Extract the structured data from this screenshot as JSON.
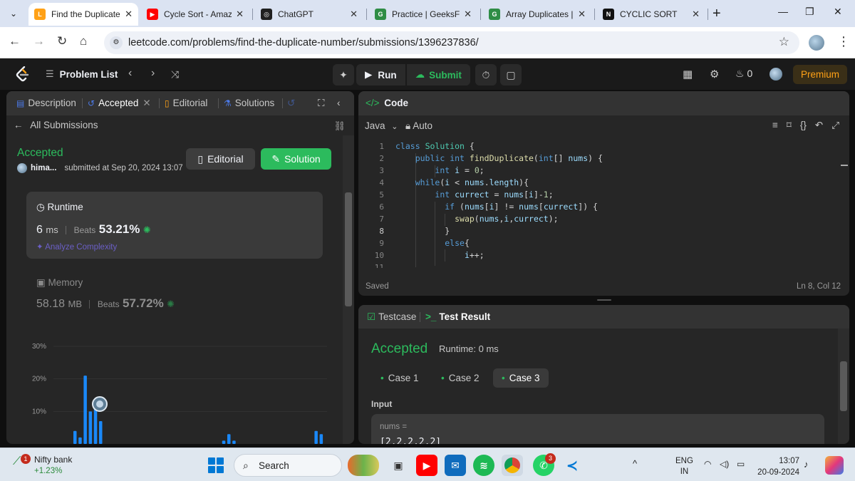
{
  "browser": {
    "tabs": [
      {
        "title": "Find the Duplicate",
        "color": "#ffa116",
        "glyph": "L"
      },
      {
        "title": "Cycle Sort - Amazo",
        "color": "#ff0000",
        "glyph": "▶"
      },
      {
        "title": "ChatGPT",
        "color": "#202020",
        "glyph": "◎"
      },
      {
        "title": "Practice | GeeksFor",
        "color": "#2f8d46",
        "glyph": "G"
      },
      {
        "title": "Array Duplicates |",
        "color": "#2f8d46",
        "glyph": "G"
      },
      {
        "title": "CYCLIC SORT",
        "color": "#111111",
        "glyph": "N"
      }
    ],
    "url": "leetcode.com/problems/find-the-duplicate-number/submissions/1396237836/"
  },
  "lc": {
    "problem_list": "Problem List",
    "run": "Run",
    "submit": "Submit",
    "streak": "0",
    "premium": "Premium"
  },
  "left": {
    "tabs": {
      "description": "Description",
      "accepted": "Accepted",
      "editorial": "Editorial",
      "solutions": "Solutions"
    },
    "all_submissions": "All Submissions",
    "status": "Accepted",
    "user": "hima...",
    "submitted_at": "submitted at Sep 20, 2024 13:07",
    "editorial_btn": "Editorial",
    "solution_btn": "Solution",
    "runtime": {
      "label": "Runtime",
      "value": "6",
      "unit": "ms",
      "beats": "Beats",
      "pct": "53.21%",
      "analyze": "Analyze Complexity"
    },
    "memory": {
      "label": "Memory",
      "value": "58.18",
      "unit": "MB",
      "beats": "Beats",
      "pct": "57.72%"
    }
  },
  "chart_data": {
    "type": "bar",
    "y_tick_labels": [
      "30%",
      "20%",
      "10%"
    ],
    "yticks": [
      30,
      20,
      10
    ],
    "ylim": [
      0,
      30
    ],
    "bars": [
      {
        "x": 0,
        "y": 4
      },
      {
        "x": 1,
        "y": 2
      },
      {
        "x": 2,
        "y": 21
      },
      {
        "x": 3,
        "y": 10
      },
      {
        "x": 4,
        "y": 12
      },
      {
        "x": 5,
        "y": 7
      },
      {
        "x": 29,
        "y": 1
      },
      {
        "x": 30,
        "y": 3
      },
      {
        "x": 31,
        "y": 1
      },
      {
        "x": 47,
        "y": 4
      },
      {
        "x": 48,
        "y": 3
      }
    ],
    "color": "#1a88f8"
  },
  "code": {
    "title": "Code",
    "language": "Java",
    "mode": "Auto",
    "saved": "Saved",
    "cursor": "Ln 8, Col 12",
    "lines": [
      {
        "n": "1",
        "text": "class Solution {"
      },
      {
        "n": "2",
        "text": "    public int findDuplicate(int[] nums) {"
      },
      {
        "n": "3",
        "text": "        int i = 0;"
      },
      {
        "n": "4",
        "text": "    while(i < nums.length){"
      },
      {
        "n": "5",
        "text": "        int currect = nums[i]-1;"
      },
      {
        "n": "6",
        "text": "          if (nums[i] != nums[currect]) {"
      },
      {
        "n": "7",
        "text": "            swap(nums,i,currect);"
      },
      {
        "n": "8",
        "text": "          }"
      },
      {
        "n": "9",
        "text": "          else{"
      },
      {
        "n": "10",
        "text": "              i++;"
      },
      {
        "n": "11",
        "text": ""
      }
    ]
  },
  "test": {
    "testcase_tab": "Testcase",
    "result_tab": "Test Result",
    "status": "Accepted",
    "runtime": "Runtime: 0 ms",
    "cases": [
      "Case 1",
      "Case 2",
      "Case 3"
    ],
    "input_label": "Input",
    "input_name": "nums =",
    "input_value": "[2,2,2,2,2]"
  },
  "taskbar": {
    "nifty": "Nifty bank",
    "nifty_change": "+1.23%",
    "nifty_badge": "1",
    "search": "Search",
    "whatsapp_badge": "3",
    "lang1": "ENG",
    "lang2": "IN",
    "time": "13:07",
    "date": "20-09-2024"
  }
}
